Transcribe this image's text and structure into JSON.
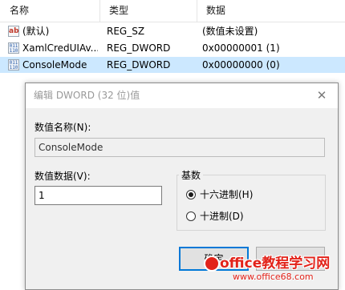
{
  "list": {
    "columns": [
      "名称",
      "类型",
      "数据"
    ],
    "rows": [
      {
        "icon": "string-value-icon",
        "icon_text": "ab",
        "name": "(默认)",
        "type": "REG_SZ",
        "data": "(数值未设置)",
        "selected": false
      },
      {
        "icon": "binary-value-icon",
        "icon_text": "011\n110",
        "name": "XamlCredUIAv...",
        "type": "REG_DWORD",
        "data": "0x00000001 (1)",
        "selected": false
      },
      {
        "icon": "binary-value-icon",
        "icon_text": "011\n110",
        "name": "ConsoleMode",
        "type": "REG_DWORD",
        "data": "0x00000000 (0)",
        "selected": true
      }
    ]
  },
  "dialog": {
    "title": "编辑 DWORD (32 位)值",
    "close_glyph": "✕",
    "value_name_label": "数值名称(N):",
    "value_name": "ConsoleMode",
    "value_data_label": "数值数据(V):",
    "value_data": "1",
    "base_label": "基数",
    "base_options": [
      {
        "label": "十六进制(H)",
        "checked": true
      },
      {
        "label": "十进制(D)",
        "checked": false
      }
    ],
    "ok_label": "确定",
    "cancel_label": ""
  },
  "watermark": {
    "title": "office教程学习网",
    "url": "www.office68.com"
  },
  "colors": {
    "selection": "#cce8ff",
    "dialog_bg": "#f0f0f0",
    "default_button_border": "#0078d7",
    "watermark": "#e2231a"
  }
}
